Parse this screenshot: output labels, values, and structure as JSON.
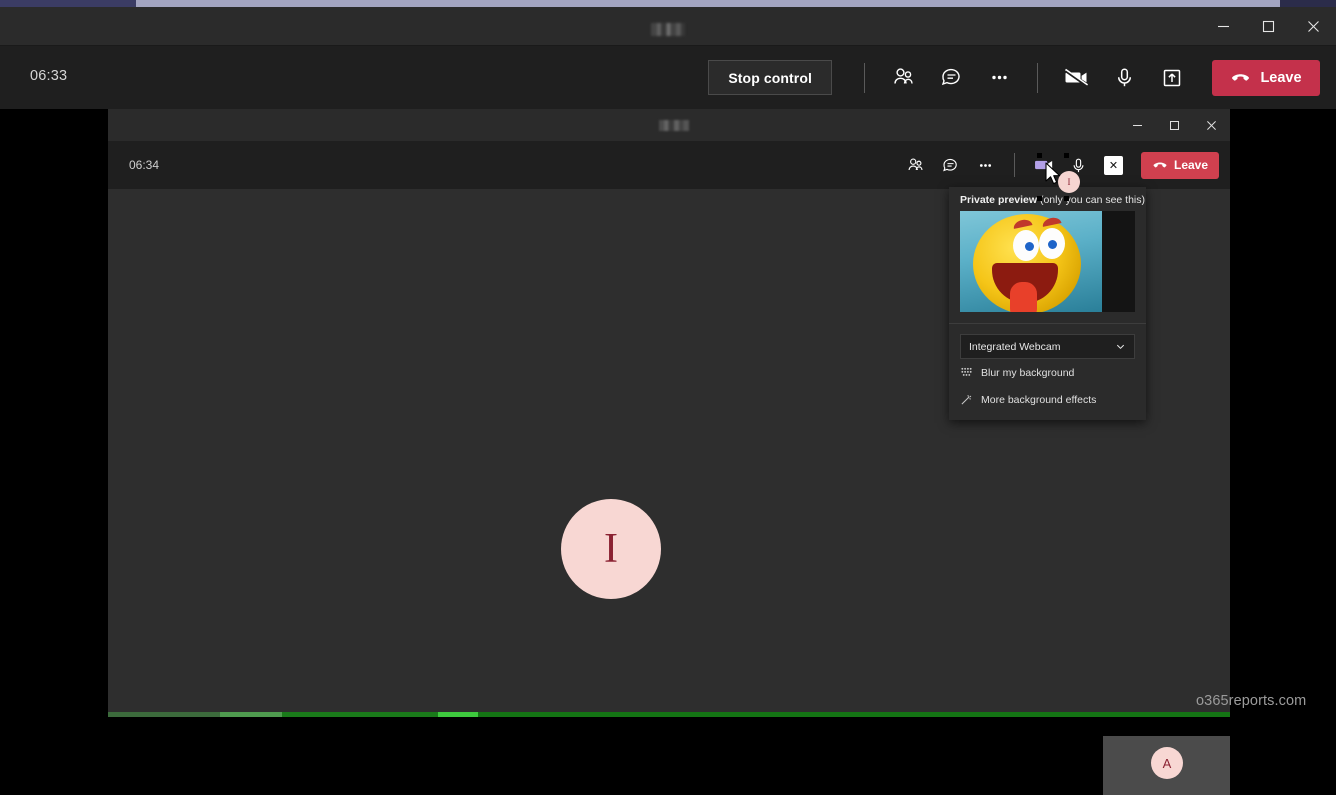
{
  "top_strip": {
    "name": "browser-chrome-strip"
  },
  "outer_window": {
    "title": "",
    "timer": "06:33",
    "stop_control_label": "Stop control",
    "leave_label": "Leave",
    "window_controls": {
      "minimize": "minimize-icon",
      "maximize": "maximize-icon",
      "close": "close-icon"
    },
    "icons": {
      "people": "people-icon",
      "chat": "chat-icon",
      "more": "more-options-icon",
      "camera_off": "camera-off-icon",
      "microphone": "microphone-icon",
      "share": "share-screen-icon",
      "leave_phone": "phone-hangup-icon"
    }
  },
  "inner_window": {
    "title": "",
    "timer": "06:34",
    "leave_label": "Leave",
    "stop_share_label": "✕",
    "window_controls": {
      "minimize": "minimize-icon",
      "maximize": "maximize-icon",
      "close": "close-icon"
    },
    "icons": {
      "people": "people-icon",
      "chat": "chat-icon",
      "more": "more-options-icon",
      "camera": "camera-on-icon",
      "microphone": "microphone-icon",
      "stop_share": "stop-sharing-icon",
      "leave_phone": "phone-hangup-icon"
    },
    "stage": {
      "main_avatar_initial": "I",
      "self_tile_initial": "A"
    }
  },
  "popup": {
    "header_bold": "Private preview",
    "header_rest": " (only you can see this)",
    "device_name": "Integrated Webcam",
    "chevron": "chevron-down-icon",
    "rows": [
      {
        "label": "Blur my background",
        "icon": "blur-icon"
      },
      {
        "label": "More background effects",
        "icon": "magic-wand-icon"
      }
    ]
  },
  "watermark": "o365reports.com",
  "colors": {
    "accent_leave": "#c4314b",
    "inner_leave": "#d0404f",
    "avatar_bg": "#f8d7d3",
    "avatar_fg": "#8b2232",
    "camera_highlight": "#b3a0e8",
    "share_border": "#147414",
    "titlebar": "#2b2b2b",
    "toolbar": "#1f1f1f",
    "stage": "#2e2e2e"
  }
}
